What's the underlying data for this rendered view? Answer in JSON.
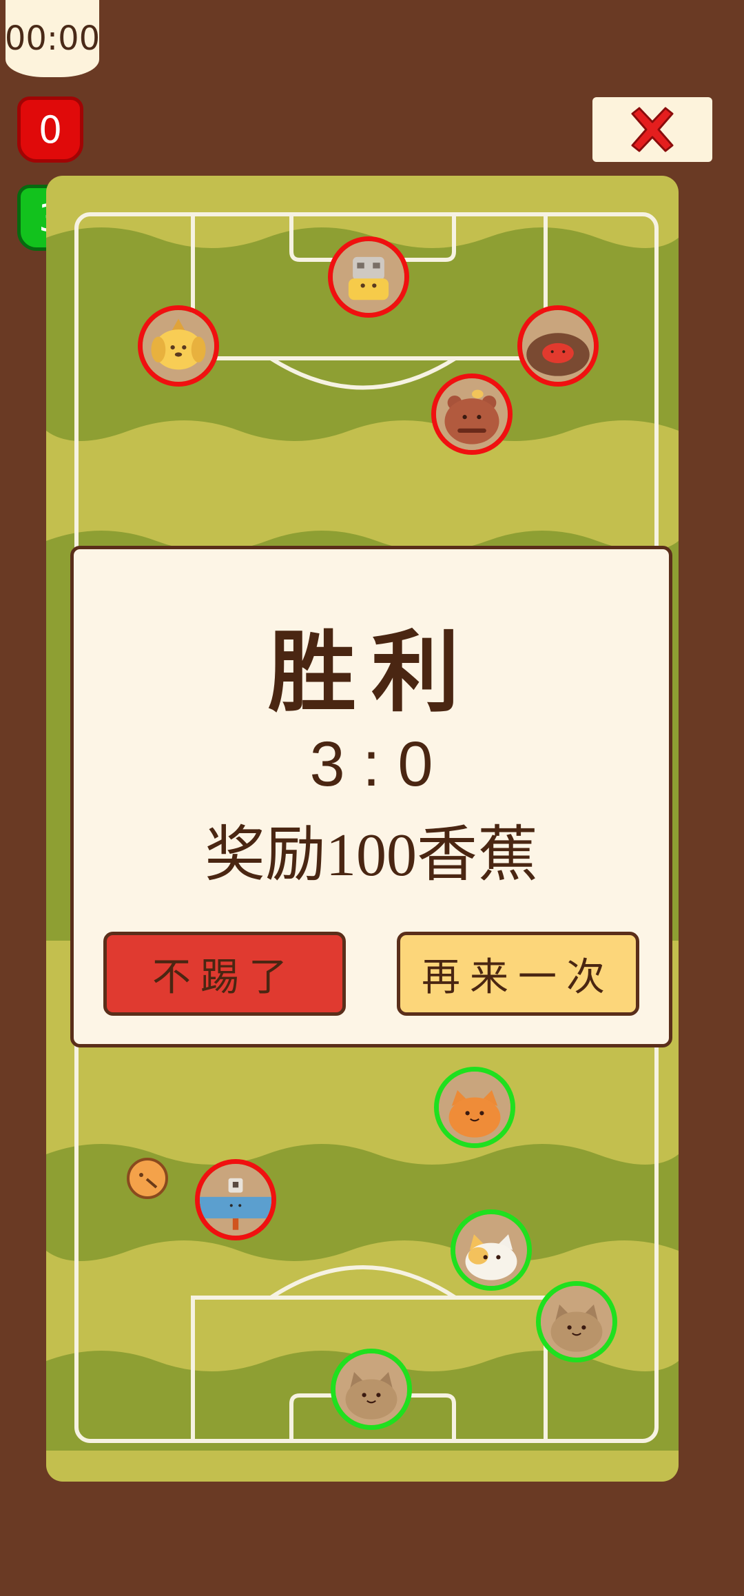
{
  "hud": {
    "timer": "00:00",
    "opponent_score": "0",
    "player_score": "3"
  },
  "result_dialog": {
    "title": "胜利",
    "score": "3 : 0",
    "reward": "奖励100香蕉",
    "quit_label": "不踢了",
    "retry_label": "再来一次"
  },
  "colors": {
    "background": "#6a3a24",
    "field_light": "#c3bf4e",
    "field_dark": "#8e9f33",
    "opponent_ring": "#f01010",
    "player_ring": "#1fe01f",
    "dialog_bg": "#fdf5e6",
    "quit_button": "#e03a30",
    "retry_button": "#fcd67a"
  },
  "opponents": [
    "robot-player-icon",
    "dog-wizard-player-icon",
    "sloth-player-icon",
    "bear-player-icon",
    "blue-creature-player-icon"
  ],
  "teammates": [
    "orange-cat-player-icon",
    "white-cat-player-icon",
    "brown-cat-player-icon",
    "goalkeeper-cat-player-icon"
  ]
}
